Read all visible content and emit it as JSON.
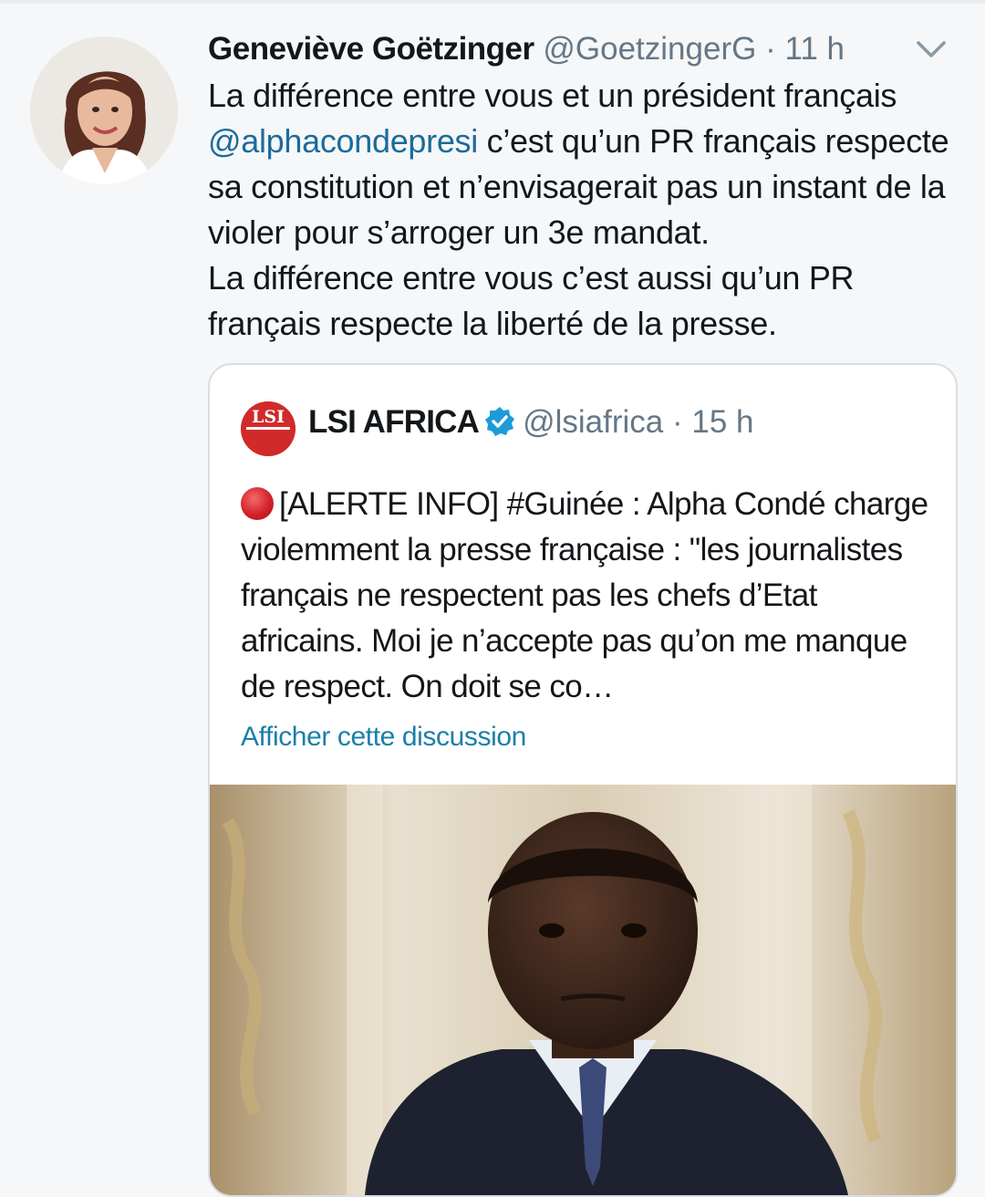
{
  "tweet": {
    "author_name": "Geneviève Goëtzinger",
    "author_handle": "@GoetzingerG",
    "separator": "·",
    "time": "11 h",
    "avatar_icon": "profile-photo",
    "menu_icon": "chevron-down-icon",
    "mention": "@alphacondepresi",
    "text_line1": "La différence entre vous et un président français",
    "text_after_mention": " c’est qu’un PR français",
    "text_rest1": "respecte sa constitution et n’envisagerait pas un instant de la violer pour s’arroger un 3e mandat.",
    "text_rest2": "La différence entre vous c’est aussi qu’un PR français respecte la liberté de la presse."
  },
  "quoted": {
    "author_name": "LSI AFRICA",
    "logo_text": "LSI",
    "verified_icon": "verified-badge-icon",
    "author_handle": "@lsiafrica",
    "separator": "·",
    "time": "15 h",
    "alert_icon": "red-circle-icon",
    "text": "[ALERTE INFO] #Guinée : Alpha Condé charge violemment la presse française : \"les journalistes français ne respectent pas les chefs d’Etat africains. Moi je n’accepte pas qu’on me manque de respect. On doit se co…",
    "show_thread": "Afficher cette discussion",
    "photo_icon": "portrait-photo"
  },
  "colors": {
    "link": "#1b6b9c",
    "secondary": "#657786",
    "verified": "#1da1f2",
    "logo": "#d12a2a"
  }
}
